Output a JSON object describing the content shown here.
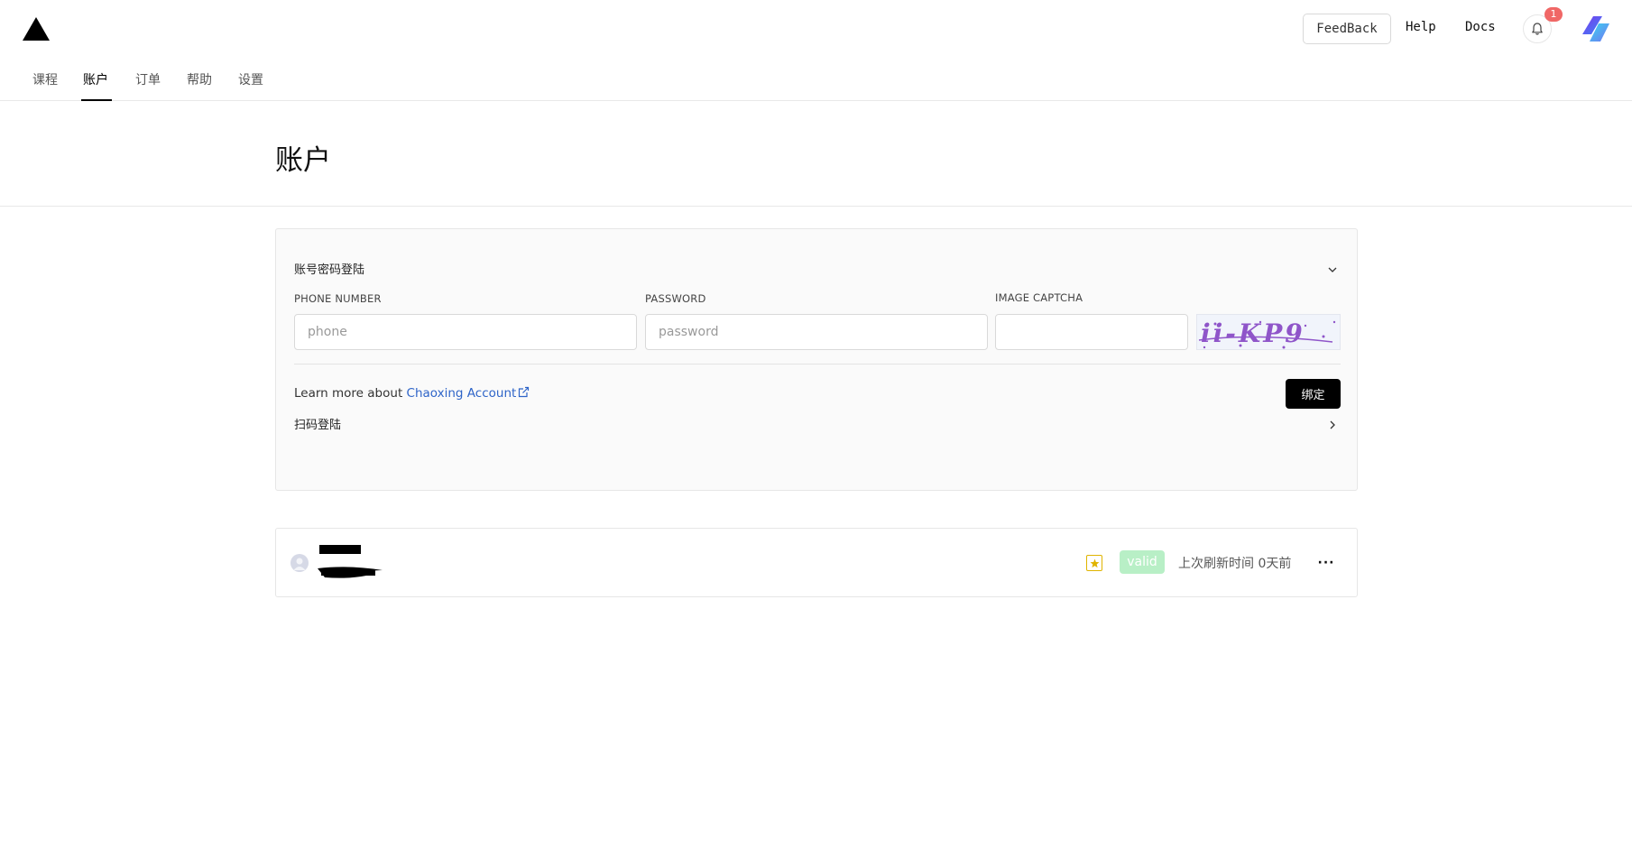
{
  "header": {
    "feedback_label": "FeedBack",
    "help_label": "Help",
    "docs_label": "Docs",
    "notification_count": "1"
  },
  "tabs": [
    {
      "label": "课程",
      "active": false
    },
    {
      "label": "账户",
      "active": true
    },
    {
      "label": "订单",
      "active": false
    },
    {
      "label": "帮助",
      "active": false
    },
    {
      "label": "设置",
      "active": false
    }
  ],
  "page": {
    "title": "账户"
  },
  "login_card": {
    "password_section_title": "账号密码登陆",
    "phone_label": "PHONE NUMBER",
    "phone_placeholder": "phone",
    "password_label": "PASSWORD",
    "password_placeholder": "password",
    "captcha_label": "IMAGE CAPTCHA",
    "captcha_text": "ii-KP9",
    "learn_more_prefix": "Learn more about ",
    "learn_more_link": "Chaoxing Account",
    "bind_button": "绑定",
    "qr_section_title": "扫码登陆"
  },
  "account": {
    "status": "valid",
    "refresh_text": "上次刷新时间 0天前",
    "more_label": "···"
  },
  "colors": {
    "accent_link": "#2e64c8",
    "badge_red": "#f06766",
    "valid_green": "#b8efc6",
    "star_yellow": "#e0b400",
    "captcha_purple": "#8f55c9"
  }
}
